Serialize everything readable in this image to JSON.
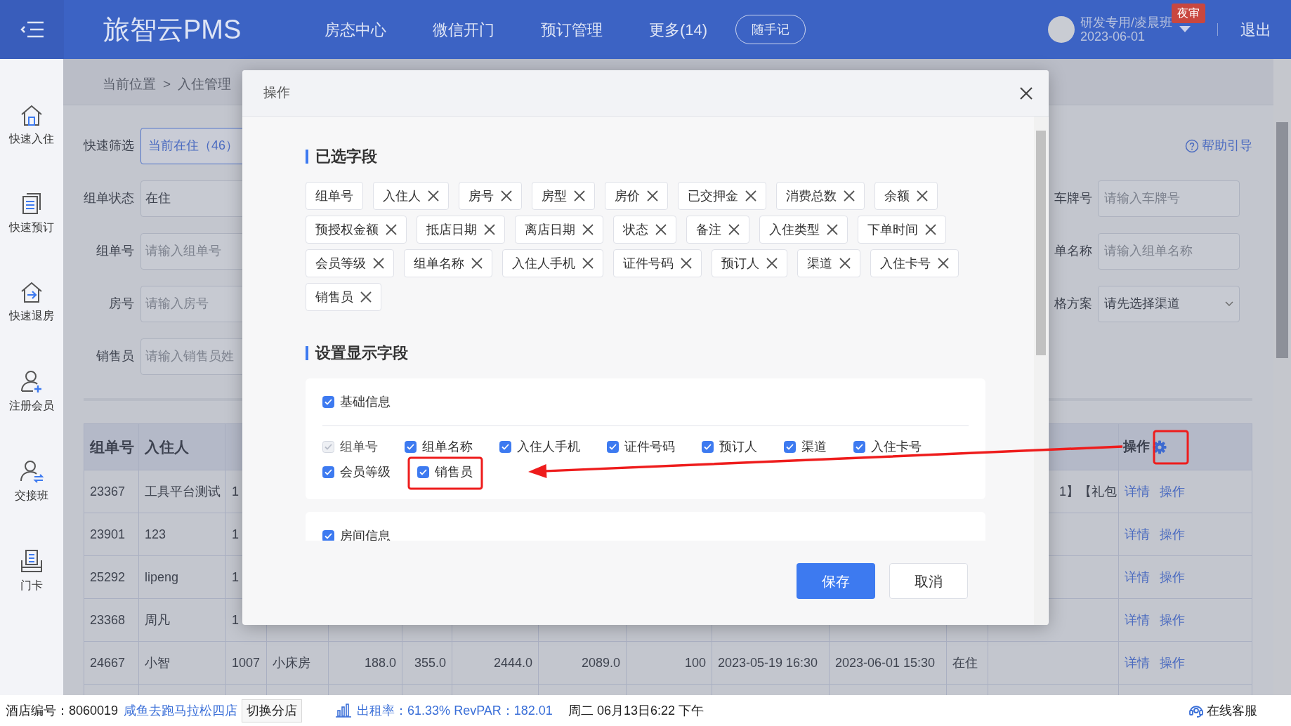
{
  "header": {
    "title": "旅智云PMS",
    "nav": [
      {
        "label": "房态中心"
      },
      {
        "label": "微信开门"
      },
      {
        "label": "预订管理"
      },
      {
        "label": "更多(14)"
      }
    ],
    "note_button": "随手记",
    "user": {
      "name": "研发专用/凌晨班",
      "date": "2023-06-01",
      "badge": "夜审"
    },
    "logout": "退出"
  },
  "sidebar": {
    "items": [
      {
        "label": "快速入住"
      },
      {
        "label": "快速预订"
      },
      {
        "label": "快速退房"
      },
      {
        "label": "注册会员"
      },
      {
        "label": "交接班"
      },
      {
        "label": "门卡"
      }
    ]
  },
  "breadcrumb": {
    "location": "当前位置",
    "separator": ">",
    "current": "入住管理"
  },
  "help_link": "帮助引导",
  "filters": {
    "quick": {
      "label": "快速筛选",
      "button": "当前在住（46）"
    },
    "left": [
      {
        "label": "组单状态",
        "value": "在住"
      },
      {
        "label": "组单号",
        "placeholder": "请输入组单号"
      },
      {
        "label": "房号",
        "placeholder": "请输入房号"
      },
      {
        "label": "销售员",
        "placeholder": "请输入销售员姓"
      }
    ],
    "right": [
      {
        "label": "车牌号",
        "placeholder": "请输入车牌号",
        "kind": "input"
      },
      {
        "label": "单名称",
        "placeholder": "请输入组单名称",
        "kind": "input"
      },
      {
        "label": "格方案",
        "value": "请先选择渠道",
        "kind": "select"
      }
    ]
  },
  "table": {
    "columns": [
      "组单号",
      "入住人",
      null,
      null,
      null,
      null,
      null,
      null,
      null,
      null,
      null,
      null,
      null
    ],
    "action_column": "操作",
    "rows": [
      {
        "cells": [
          "23367",
          "工具平台测试",
          "1",
          null,
          null,
          null,
          null,
          null,
          null,
          null,
          null,
          null,
          "1】【礼包"
        ],
        "actions": [
          "详情",
          "操作"
        ]
      },
      {
        "cells": [
          "23901",
          "123",
          "1",
          null,
          null,
          null,
          null,
          null,
          null,
          null,
          null,
          null,
          null
        ],
        "actions": [
          "详情",
          "操作"
        ]
      },
      {
        "cells": [
          "25292",
          "lipeng",
          "1",
          null,
          null,
          null,
          null,
          null,
          null,
          null,
          null,
          null,
          null
        ],
        "actions": [
          "详情",
          "操作"
        ]
      },
      {
        "cells": [
          "23368",
          "周凡",
          "1",
          null,
          null,
          null,
          null,
          null,
          null,
          null,
          null,
          null,
          null
        ],
        "actions": [
          "详情",
          "操作"
        ]
      },
      {
        "cells": [
          "24667",
          "小智",
          "1007",
          "小床房",
          "188.0",
          "355.0",
          "2444.0",
          "2089.0",
          "100",
          "2023-05-19 16:30",
          "2023-06-01 15:30",
          "在住",
          null
        ],
        "actions": [
          "详情",
          "操作"
        ]
      }
    ]
  },
  "dialog": {
    "title": "操作",
    "selected_heading": "已选字段",
    "tags": [
      {
        "label": "组单号",
        "removable": false
      },
      {
        "label": "入住人",
        "removable": true
      },
      {
        "label": "房号",
        "removable": true
      },
      {
        "label": "房型",
        "removable": true
      },
      {
        "label": "房价",
        "removable": true
      },
      {
        "label": "已交押金",
        "removable": true
      },
      {
        "label": "消费总数",
        "removable": true
      },
      {
        "label": "余额",
        "removable": true
      },
      {
        "label": "预授权金额",
        "removable": true
      },
      {
        "label": "抵店日期",
        "removable": true
      },
      {
        "label": "离店日期",
        "removable": true
      },
      {
        "label": "状态",
        "removable": true
      },
      {
        "label": "备注",
        "removable": true
      },
      {
        "label": "入住类型",
        "removable": true
      },
      {
        "label": "下单时间",
        "removable": true
      },
      {
        "label": "会员等级",
        "removable": true
      },
      {
        "label": "组单名称",
        "removable": true
      },
      {
        "label": "入住人手机",
        "removable": true
      },
      {
        "label": "证件号码",
        "removable": true
      },
      {
        "label": "预订人",
        "removable": true
      },
      {
        "label": "渠道",
        "removable": true
      },
      {
        "label": "入住卡号",
        "removable": true
      },
      {
        "label": "销售员",
        "removable": true
      }
    ],
    "display_heading": "设置显示字段",
    "groups": [
      {
        "label": "基础信息",
        "checked": true,
        "fields": [
          {
            "label": "组单号",
            "checked": true,
            "disabled": true
          },
          {
            "label": "组单名称",
            "checked": true,
            "disabled": false
          },
          {
            "label": "入住人手机",
            "checked": true,
            "disabled": false
          },
          {
            "label": "证件号码",
            "checked": true,
            "disabled": false
          },
          {
            "label": "预订人",
            "checked": true,
            "disabled": false
          },
          {
            "label": "渠道",
            "checked": true,
            "disabled": false
          },
          {
            "label": "入住卡号",
            "checked": true,
            "disabled": false
          },
          {
            "label": "会员等级",
            "checked": true,
            "disabled": false
          },
          {
            "label": "销售员",
            "checked": true,
            "disabled": false
          }
        ]
      },
      {
        "label": "房间信息",
        "checked": true
      }
    ],
    "buttons": {
      "save": "保存",
      "cancel": "取消"
    }
  },
  "status_bar": {
    "hotel_label": "酒店编号：",
    "hotel_no": "8060019",
    "store": "咸鱼去跑马拉松四店",
    "switch": "切换分店",
    "occupancy": "出租率：61.33% RevPAR：182.01",
    "datetime": "周二 06月13日6:22 下午",
    "support": "在线客服"
  }
}
